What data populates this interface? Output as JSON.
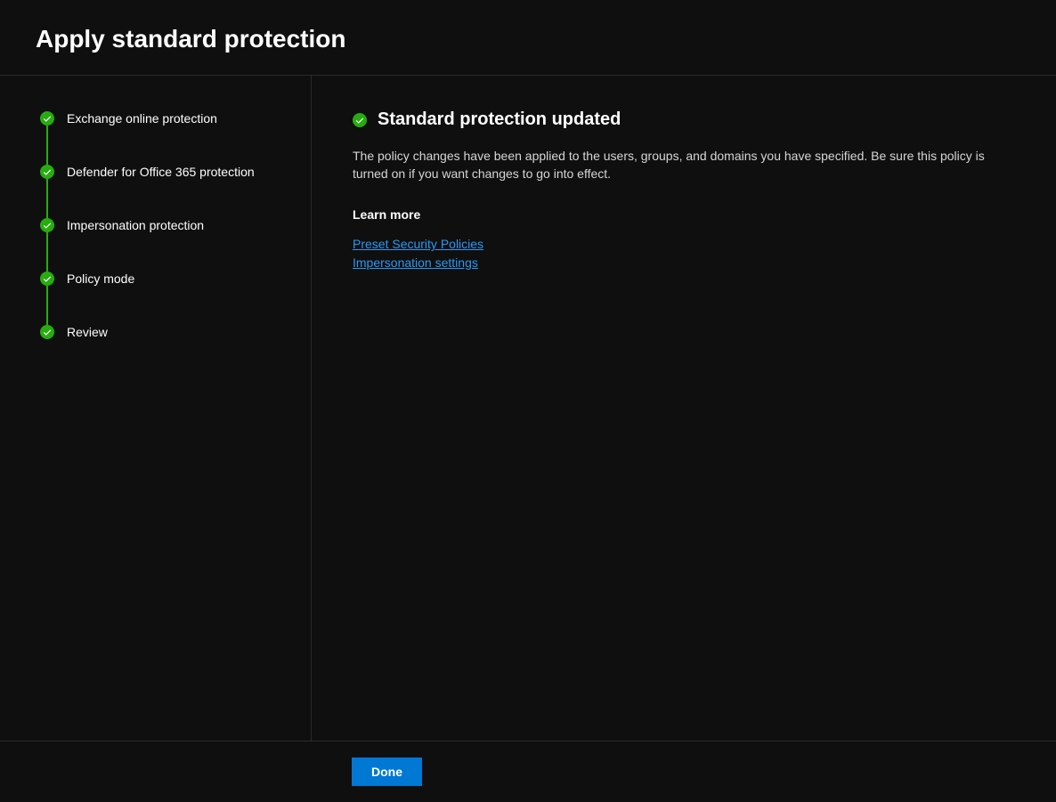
{
  "header": {
    "title": "Apply standard protection"
  },
  "sidebar": {
    "steps": [
      {
        "label": "Exchange online protection"
      },
      {
        "label": "Defender for Office 365 protection"
      },
      {
        "label": "Impersonation protection"
      },
      {
        "label": "Policy mode"
      },
      {
        "label": "Review"
      }
    ]
  },
  "content": {
    "status_title": "Standard protection updated",
    "description": "The policy changes have been applied to the users, groups, and domains you have specified. Be sure this policy is turned on if you want changes to go into effect.",
    "learn_more_heading": "Learn more",
    "links": [
      {
        "label": "Preset Security Policies"
      },
      {
        "label": "Impersonation settings"
      }
    ]
  },
  "footer": {
    "done_label": "Done"
  }
}
